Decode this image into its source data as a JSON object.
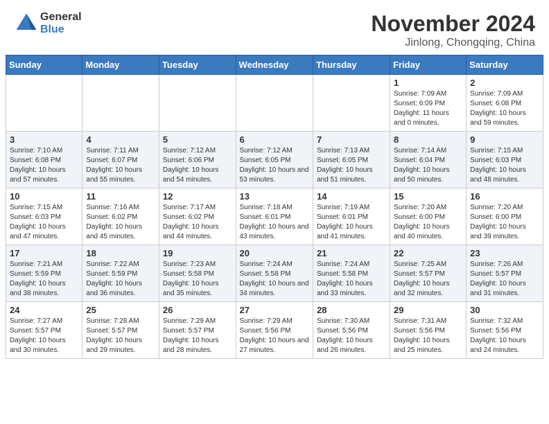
{
  "header": {
    "logo_general": "General",
    "logo_blue": "Blue",
    "month": "November 2024",
    "location": "Jinlong, Chongqing, China"
  },
  "weekdays": [
    "Sunday",
    "Monday",
    "Tuesday",
    "Wednesday",
    "Thursday",
    "Friday",
    "Saturday"
  ],
  "weeks": [
    [
      {
        "day": "",
        "info": ""
      },
      {
        "day": "",
        "info": ""
      },
      {
        "day": "",
        "info": ""
      },
      {
        "day": "",
        "info": ""
      },
      {
        "day": "",
        "info": ""
      },
      {
        "day": "1",
        "info": "Sunrise: 7:09 AM\nSunset: 6:09 PM\nDaylight: 11 hours and 0 minutes."
      },
      {
        "day": "2",
        "info": "Sunrise: 7:09 AM\nSunset: 6:08 PM\nDaylight: 10 hours and 59 minutes."
      }
    ],
    [
      {
        "day": "3",
        "info": "Sunrise: 7:10 AM\nSunset: 6:08 PM\nDaylight: 10 hours and 57 minutes."
      },
      {
        "day": "4",
        "info": "Sunrise: 7:11 AM\nSunset: 6:07 PM\nDaylight: 10 hours and 55 minutes."
      },
      {
        "day": "5",
        "info": "Sunrise: 7:12 AM\nSunset: 6:06 PM\nDaylight: 10 hours and 54 minutes."
      },
      {
        "day": "6",
        "info": "Sunrise: 7:12 AM\nSunset: 6:05 PM\nDaylight: 10 hours and 53 minutes."
      },
      {
        "day": "7",
        "info": "Sunrise: 7:13 AM\nSunset: 6:05 PM\nDaylight: 10 hours and 51 minutes."
      },
      {
        "day": "8",
        "info": "Sunrise: 7:14 AM\nSunset: 6:04 PM\nDaylight: 10 hours and 50 minutes."
      },
      {
        "day": "9",
        "info": "Sunrise: 7:15 AM\nSunset: 6:03 PM\nDaylight: 10 hours and 48 minutes."
      }
    ],
    [
      {
        "day": "10",
        "info": "Sunrise: 7:15 AM\nSunset: 6:03 PM\nDaylight: 10 hours and 47 minutes."
      },
      {
        "day": "11",
        "info": "Sunrise: 7:16 AM\nSunset: 6:02 PM\nDaylight: 10 hours and 45 minutes."
      },
      {
        "day": "12",
        "info": "Sunrise: 7:17 AM\nSunset: 6:02 PM\nDaylight: 10 hours and 44 minutes."
      },
      {
        "day": "13",
        "info": "Sunrise: 7:18 AM\nSunset: 6:01 PM\nDaylight: 10 hours and 43 minutes."
      },
      {
        "day": "14",
        "info": "Sunrise: 7:19 AM\nSunset: 6:01 PM\nDaylight: 10 hours and 41 minutes."
      },
      {
        "day": "15",
        "info": "Sunrise: 7:20 AM\nSunset: 6:00 PM\nDaylight: 10 hours and 40 minutes."
      },
      {
        "day": "16",
        "info": "Sunrise: 7:20 AM\nSunset: 6:00 PM\nDaylight: 10 hours and 39 minutes."
      }
    ],
    [
      {
        "day": "17",
        "info": "Sunrise: 7:21 AM\nSunset: 5:59 PM\nDaylight: 10 hours and 38 minutes."
      },
      {
        "day": "18",
        "info": "Sunrise: 7:22 AM\nSunset: 5:59 PM\nDaylight: 10 hours and 36 minutes."
      },
      {
        "day": "19",
        "info": "Sunrise: 7:23 AM\nSunset: 5:58 PM\nDaylight: 10 hours and 35 minutes."
      },
      {
        "day": "20",
        "info": "Sunrise: 7:24 AM\nSunset: 5:58 PM\nDaylight: 10 hours and 34 minutes."
      },
      {
        "day": "21",
        "info": "Sunrise: 7:24 AM\nSunset: 5:58 PM\nDaylight: 10 hours and 33 minutes."
      },
      {
        "day": "22",
        "info": "Sunrise: 7:25 AM\nSunset: 5:57 PM\nDaylight: 10 hours and 32 minutes."
      },
      {
        "day": "23",
        "info": "Sunrise: 7:26 AM\nSunset: 5:57 PM\nDaylight: 10 hours and 31 minutes."
      }
    ],
    [
      {
        "day": "24",
        "info": "Sunrise: 7:27 AM\nSunset: 5:57 PM\nDaylight: 10 hours and 30 minutes."
      },
      {
        "day": "25",
        "info": "Sunrise: 7:28 AM\nSunset: 5:57 PM\nDaylight: 10 hours and 29 minutes."
      },
      {
        "day": "26",
        "info": "Sunrise: 7:29 AM\nSunset: 5:57 PM\nDaylight: 10 hours and 28 minutes."
      },
      {
        "day": "27",
        "info": "Sunrise: 7:29 AM\nSunset: 5:56 PM\nDaylight: 10 hours and 27 minutes."
      },
      {
        "day": "28",
        "info": "Sunrise: 7:30 AM\nSunset: 5:56 PM\nDaylight: 10 hours and 26 minutes."
      },
      {
        "day": "29",
        "info": "Sunrise: 7:31 AM\nSunset: 5:56 PM\nDaylight: 10 hours and 25 minutes."
      },
      {
        "day": "30",
        "info": "Sunrise: 7:32 AM\nSunset: 5:56 PM\nDaylight: 10 hours and 24 minutes."
      }
    ]
  ]
}
